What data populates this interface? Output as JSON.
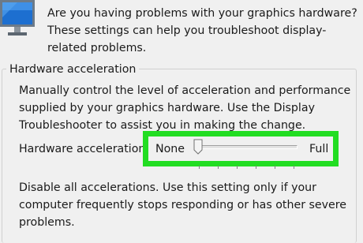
{
  "intro": {
    "text": "Are you having problems with your graphics hardware? These settings can help you troubleshoot display-related problems.",
    "icon": "monitor-icon"
  },
  "hardware_acceleration": {
    "group_title": "Hardware acceleration",
    "description": "Manually control the level of acceleration and performance supplied by your graphics hardware. Use the Display Troubleshooter to assist you in making the change.",
    "slider": {
      "label": "Hardware acceleration:",
      "min_label": "None",
      "max_label": "Full",
      "value_fraction": 0.0,
      "tick_count": 6
    },
    "status_text": "Disable all accelerations. Use this setting only if your computer frequently stops responding or has other severe problems."
  },
  "colors": {
    "highlight": "#22dd22",
    "background": "#f0f0f0"
  }
}
